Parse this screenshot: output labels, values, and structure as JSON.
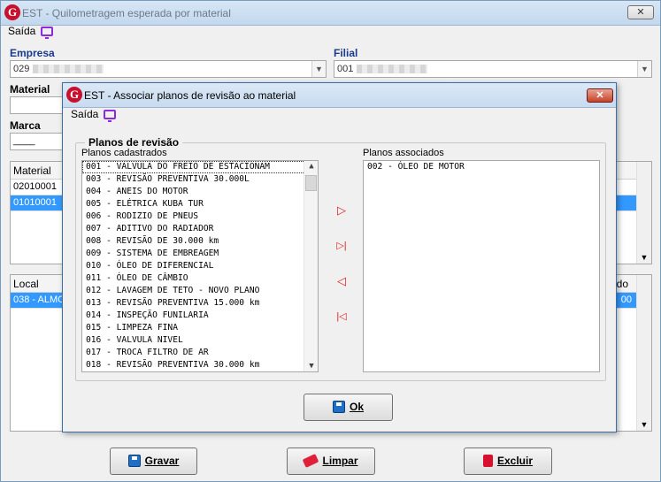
{
  "main": {
    "title": "EST - Quilometragem esperada por material",
    "menu_saida": "Saída",
    "empresa_label": "Empresa",
    "empresa_value": "029",
    "filial_label": "Filial",
    "filial_value": "001",
    "material_label": "Material",
    "marca_label": "Marca",
    "marca_value": "____",
    "grid1": {
      "header": "Material",
      "rows": [
        "02010001",
        "01010001"
      ]
    },
    "grid2": {
      "header": "Local",
      "header_right": "do",
      "rows": [
        "038 - ALMO"
      ],
      "row_right": "00"
    },
    "buttons": {
      "gravar": "Gravar",
      "limpar": "Limpar",
      "excluir": "Excluir"
    }
  },
  "dialog": {
    "title": "EST - Associar planos de revisão ao material",
    "menu_saida": "Saída",
    "group_label": "Planos de revisão",
    "left_label": "Planos cadastrados",
    "right_label": "Planos associados",
    "planos_cadastrados": [
      "001 - VALVULA DO FREIO DE ESTACIONAM",
      "003 - REVISÃO PREVENTIVA 30.000L",
      "004 -  ANEIS DO MOTOR",
      "005 - ELÉTRICA KUBA TUR",
      "006 - RODIZIO DE PNEUS",
      "007 - ADITIVO DO RADIADOR",
      "008 - REVISÃO DE 30.000 km",
      "009 - SISTEMA DE EMBREAGEM",
      "010 - ÓLEO DE DIFERENCIAL",
      "011 - ÓLEO DE CÂMBIO",
      "012 - LAVAGEM DE TETO - NOVO PLANO",
      "013 - REVISÃO PREVENTIVA 15.000 km",
      "014 - INSPEÇÃO FUNILARIA",
      "015 - LIMPEZA FINA",
      "016 - VALVULA NIVEL",
      "017 - TROCA FILTRO DE AR",
      "018 - REVISÃO PREVENTIVA 30.000 km"
    ],
    "planos_associados": [
      "002 - ÓLEO DE MOTOR"
    ],
    "ok_label": "Ok",
    "icons": {
      "move_right": "▷",
      "move_all_right": "▷|",
      "move_left": "◁",
      "move_all_left": "|◁"
    }
  }
}
